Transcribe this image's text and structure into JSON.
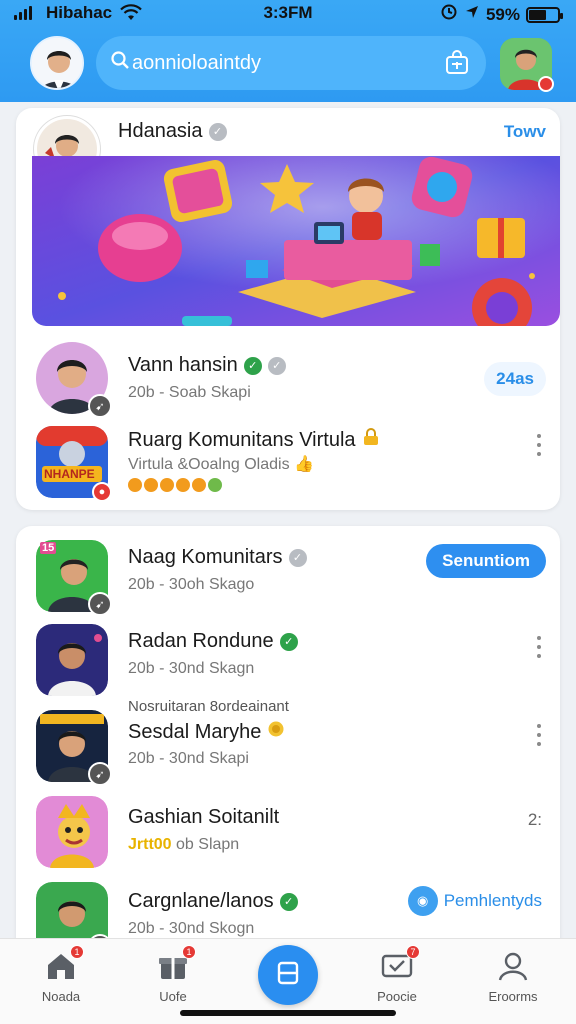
{
  "status_bar": {
    "carrier": "Hibahac",
    "time": "3:3FM",
    "battery_text": "59%",
    "battery_level": 0.59
  },
  "header": {
    "search_text": "aonnioloaintdy",
    "search_icon": "search-icon",
    "shop_icon": "shop-icon"
  },
  "feature": {
    "title": "Hdanasia",
    "action": "Towv"
  },
  "card1_rows": [
    {
      "name": "Vann hansin",
      "sub": "20b - Soab Skapi",
      "action": "24as"
    },
    {
      "name": "Ruarg Komunitans Virtula",
      "sub": "Virtula &Ooalng Oladis",
      "thumb_text": "NHANPE"
    }
  ],
  "card2_rows": [
    {
      "name": "Naag Komunitars",
      "sub": "20b - 30oh Skago",
      "action": "Senuntiom",
      "thumb_tag": "15"
    },
    {
      "name": "Radan Rondune",
      "sub": "20b - 30nd Skagn"
    },
    {
      "above": "Nosruitaran 8ordeainant",
      "name": "Sesdal Maryhe",
      "sub": "20b - 30nd Skapi"
    },
    {
      "name": "Gashian Soitanilt",
      "sub_highlight": "Jrtt00",
      "sub": "ob Slapn",
      "action": "2:"
    },
    {
      "name": "Cargnlane/lanos",
      "sub": "20b - 30nd Skogn",
      "action": "Pemhlentyds"
    }
  ],
  "bottom_nav": [
    {
      "label": "Noada",
      "icon": "home-icon",
      "badge": "1"
    },
    {
      "label": "Uofe",
      "icon": "gift-icon",
      "badge": "1"
    },
    {
      "label": "",
      "icon": "menu-icon"
    },
    {
      "label": "Poocie",
      "icon": "chat-icon",
      "badge": "7"
    },
    {
      "label": "Eroorms",
      "icon": "profile-icon"
    }
  ],
  "colors": {
    "header_blue": "#2e9af2",
    "accent_blue": "#2a8ef0",
    "verify_green": "#2ea24a",
    "badge_red": "#e53935"
  }
}
